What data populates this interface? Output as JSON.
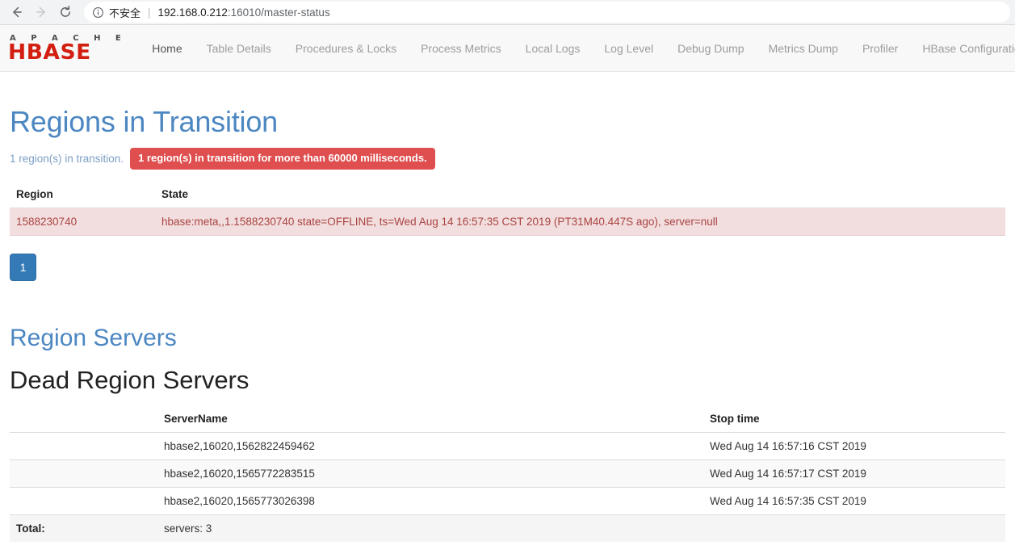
{
  "browser": {
    "back_icon": "arrow-left-icon",
    "forward_icon": "arrow-right-icon",
    "reload_icon": "reload-icon",
    "info_icon": "info-circle-icon",
    "security_label": "不安全",
    "url_host": "192.168.0.212",
    "url_rest": ":16010/master-status"
  },
  "navbar": {
    "brand_top": "A P A C H E",
    "brand_main": "HBASE",
    "items": [
      {
        "label": "Home",
        "active": true
      },
      {
        "label": "Table Details",
        "active": false
      },
      {
        "label": "Procedures & Locks",
        "active": false
      },
      {
        "label": "Process Metrics",
        "active": false
      },
      {
        "label": "Local Logs",
        "active": false
      },
      {
        "label": "Log Level",
        "active": false
      },
      {
        "label": "Debug Dump",
        "active": false
      },
      {
        "label": "Metrics Dump",
        "active": false
      },
      {
        "label": "Profiler",
        "active": false
      },
      {
        "label": "HBase Configuration",
        "active": false
      }
    ]
  },
  "regions_in_transition": {
    "heading": "Regions in Transition",
    "summary": "1 region(s) in transition.",
    "alert": "1 region(s) in transition for more than 60000 milliseconds.",
    "columns": [
      "Region",
      "State"
    ],
    "rows": [
      {
        "region": "1588230740",
        "state": "hbase:meta,,1.1588230740 state=OFFLINE, ts=Wed Aug 14 16:57:35 CST 2019 (PT31M40.447S ago), server=null"
      }
    ],
    "pagination": {
      "current": "1"
    }
  },
  "region_servers": {
    "heading": "Region Servers"
  },
  "dead_region_servers": {
    "heading": "Dead Region Servers",
    "columns": [
      "",
      "ServerName",
      "Stop time"
    ],
    "rows": [
      {
        "blank": "",
        "server_name": "hbase2,16020,1562822459462",
        "stop_time": "Wed Aug 14 16:57:16 CST 2019"
      },
      {
        "blank": "",
        "server_name": "hbase2,16020,1565772283515",
        "stop_time": "Wed Aug 14 16:57:17 CST 2019"
      },
      {
        "blank": "",
        "server_name": "hbase2,16020,1565773026398",
        "stop_time": "Wed Aug 14 16:57:35 CST 2019"
      }
    ],
    "total": {
      "label": "Total:",
      "value": "servers: 3",
      "stop_time": ""
    }
  },
  "colors": {
    "heading_blue": "#4c87c2",
    "brand_red": "#d31f12",
    "alert_red": "#e04f4f",
    "danger_bg": "#f2dede",
    "danger_text": "#a94442",
    "pagination_blue": "#337ab7"
  }
}
